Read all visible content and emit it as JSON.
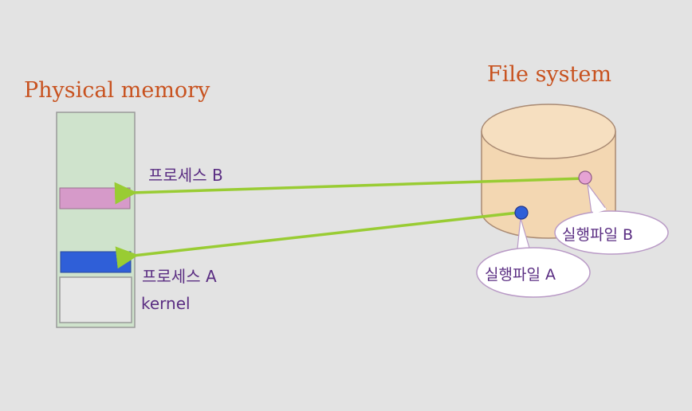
{
  "memory": {
    "title": "Physical memory",
    "process_b_label": "프로세스 B",
    "process_a_label": "프로세스 A",
    "kernel_label": "kernel"
  },
  "filesystem": {
    "title": "File system",
    "file_b_label": "실행파일 B",
    "file_a_label": "실행파일 A"
  },
  "colors": {
    "background": "#e3e3e3",
    "title_orange": "#c8521f",
    "label_purple": "#5a2d82",
    "memory_fill": "#cfe3cc",
    "process_b_pink": "#d69ac9",
    "process_a_blue": "#2f5fd8",
    "arrow_green": "#99cc33",
    "disk_fill": "#f3d7b2"
  }
}
